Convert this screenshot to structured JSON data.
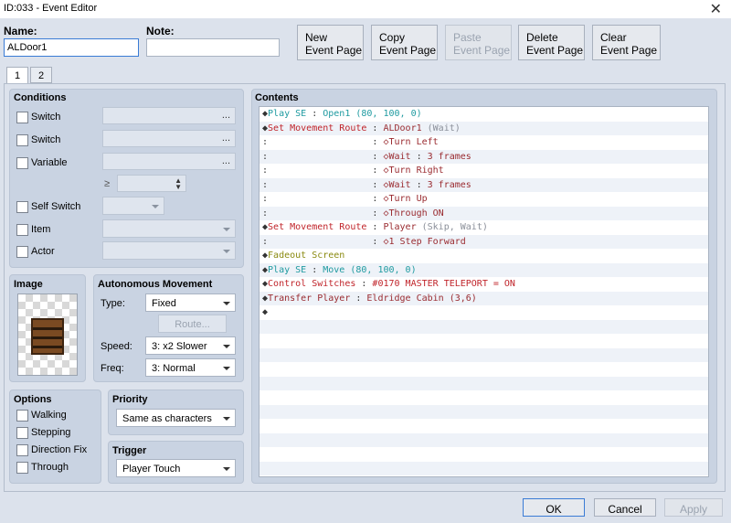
{
  "window": {
    "title": "ID:033 - Event Editor",
    "close_glyph": "✕"
  },
  "header": {
    "name_label": "Name:",
    "name_value": "ALDoor1",
    "note_label": "Note:",
    "note_value": "",
    "buttons": {
      "new": [
        "New",
        "Event Page"
      ],
      "copy": [
        "Copy",
        "Event Page"
      ],
      "paste": [
        "Paste",
        "Event Page"
      ],
      "delete": [
        "Delete",
        "Event Page"
      ],
      "clear": [
        "Clear",
        "Event Page"
      ]
    }
  },
  "tabs": [
    "1",
    "2"
  ],
  "conditions": {
    "title": "Conditions",
    "switch1": "Switch",
    "switch2": "Switch",
    "variable": "Variable",
    "gte": "≥",
    "self_switch": "Self Switch",
    "item": "Item",
    "actor": "Actor",
    "dots": "..."
  },
  "image": {
    "title": "Image"
  },
  "autonomous": {
    "title": "Autonomous Movement",
    "type_label": "Type:",
    "type_value": "Fixed",
    "route_button": "Route...",
    "speed_label": "Speed:",
    "speed_value": "3: x2 Slower",
    "freq_label": "Freq:",
    "freq_value": "3: Normal"
  },
  "options": {
    "title": "Options",
    "walking": "Walking",
    "stepping": "Stepping",
    "direction_fix": "Direction Fix",
    "through": "Through"
  },
  "priority": {
    "title": "Priority",
    "value": "Same as characters"
  },
  "trigger": {
    "title": "Trigger",
    "value": "Player Touch"
  },
  "contents": {
    "title": "Contents",
    "rows": [
      [
        [
          "◆",
          "blk"
        ],
        [
          "Play SE",
          "teal"
        ],
        [
          " : ",
          "blk"
        ],
        [
          "Open1 (80, 100, 0)",
          "teal"
        ]
      ],
      [
        [
          "◆",
          "blk"
        ],
        [
          "Set Movement Route",
          "red"
        ],
        [
          " : ",
          "blk"
        ],
        [
          "ALDoor1",
          "maroon"
        ],
        [
          " (Wait)",
          "gray"
        ]
      ],
      [
        [
          ":",
          "blk"
        ],
        [
          "                   : ",
          "blk"
        ],
        [
          "◇Turn Left",
          "maroon"
        ]
      ],
      [
        [
          ":",
          "blk"
        ],
        [
          "                   : ",
          "blk"
        ],
        [
          "◇Wait",
          "maroon"
        ],
        [
          " : ",
          "blk"
        ],
        [
          "3 frames",
          "maroon"
        ]
      ],
      [
        [
          ":",
          "blk"
        ],
        [
          "                   : ",
          "blk"
        ],
        [
          "◇Turn Right",
          "maroon"
        ]
      ],
      [
        [
          ":",
          "blk"
        ],
        [
          "                   : ",
          "blk"
        ],
        [
          "◇Wait",
          "maroon"
        ],
        [
          " : ",
          "blk"
        ],
        [
          "3 frames",
          "maroon"
        ]
      ],
      [
        [
          ":",
          "blk"
        ],
        [
          "                   : ",
          "blk"
        ],
        [
          "◇Turn Up",
          "maroon"
        ]
      ],
      [
        [
          ":",
          "blk"
        ],
        [
          "                   : ",
          "blk"
        ],
        [
          "◇Through ON",
          "maroon"
        ]
      ],
      [
        [
          "◆",
          "blk"
        ],
        [
          "Set Movement Route",
          "red"
        ],
        [
          " : ",
          "blk"
        ],
        [
          "Player",
          "maroon"
        ],
        [
          " (Skip, Wait)",
          "gray"
        ]
      ],
      [
        [
          ":",
          "blk"
        ],
        [
          "                   : ",
          "blk"
        ],
        [
          "◇1 Step Forward",
          "maroon"
        ]
      ],
      [
        [
          "◆",
          "blk"
        ],
        [
          "Fadeout Screen",
          "olive"
        ]
      ],
      [
        [
          "◆",
          "blk"
        ],
        [
          "Play SE",
          "teal"
        ],
        [
          " : ",
          "blk"
        ],
        [
          "Move (80, 100, 0)",
          "teal"
        ]
      ],
      [
        [
          "◆",
          "blk"
        ],
        [
          "Control Switches",
          "red"
        ],
        [
          " : ",
          "blk"
        ],
        [
          "#0170 MASTER TELEPORT = ON",
          "red"
        ]
      ],
      [
        [
          "◆",
          "blk"
        ],
        [
          "Transfer Player",
          "maroon"
        ],
        [
          " : ",
          "blk"
        ],
        [
          "Eldridge Cabin (3,6)",
          "maroon"
        ]
      ],
      [
        [
          "◆",
          "blk"
        ]
      ],
      [],
      [],
      [],
      [],
      [],
      [],
      [],
      [],
      [],
      [],
      []
    ]
  },
  "footer": {
    "ok": "OK",
    "cancel": "Cancel",
    "apply": "Apply"
  }
}
